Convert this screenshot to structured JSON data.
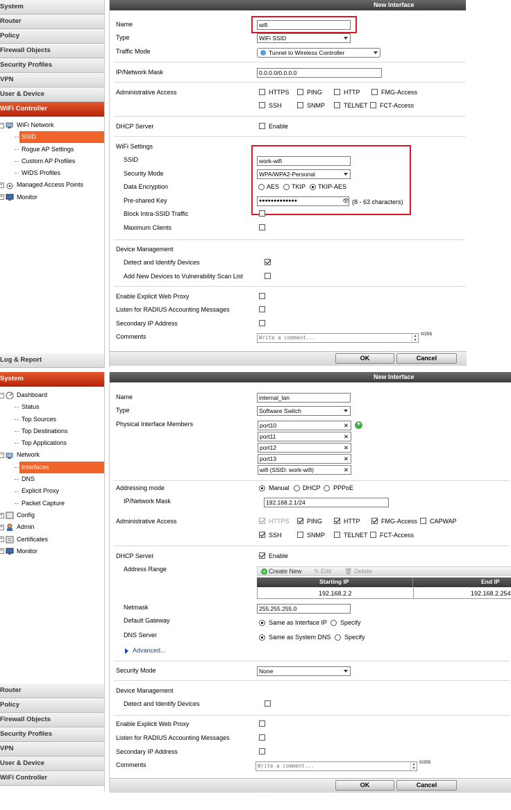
{
  "top_nav": {
    "headers_top": [
      "System",
      "Router",
      "Policy",
      "Firewall Objects",
      "Security Profiles",
      "VPN",
      "User & Device"
    ],
    "active": "WiFi Controller",
    "tree": [
      {
        "label": "WiFi Network",
        "level": 0
      },
      {
        "label": "SSID",
        "level": 1,
        "selected": true
      },
      {
        "label": "Rogue AP Settings",
        "level": 1
      },
      {
        "label": "Custom AP Profiles",
        "level": 1
      },
      {
        "label": "WIDS Profiles",
        "level": 1
      },
      {
        "label": "Managed Access Points",
        "level": 0
      },
      {
        "label": "Monitor",
        "level": 0
      }
    ],
    "footer": "Log & Report"
  },
  "bottom_nav": {
    "active": "System",
    "tree": [
      {
        "label": "Dashboard",
        "level": 0
      },
      {
        "label": "Status",
        "level": 1
      },
      {
        "label": "Top Sources",
        "level": 1
      },
      {
        "label": "Top Destinations",
        "level": 1
      },
      {
        "label": "Top Applications",
        "level": 1
      },
      {
        "label": "Network",
        "level": 0
      },
      {
        "label": "Interfaces",
        "level": 1,
        "selected": true
      },
      {
        "label": "DNS",
        "level": 1
      },
      {
        "label": "Explicit Proxy",
        "level": 1
      },
      {
        "label": "Packet Capture",
        "level": 1
      },
      {
        "label": "Config",
        "level": 0
      },
      {
        "label": "Admin",
        "level": 0
      },
      {
        "label": "Certificates",
        "level": 0
      },
      {
        "label": "Monitor",
        "level": 0
      }
    ],
    "headers_bottom": [
      "Router",
      "Policy",
      "Firewall Objects",
      "Security Profiles",
      "VPN",
      "User & Device",
      "WiFi Controller"
    ]
  },
  "wifi_form": {
    "title": "New Interface",
    "name_label": "Name",
    "name_value": "wifi",
    "type_label": "Type",
    "type_value": "WiFi SSID",
    "traffic_label": "Traffic Mode",
    "traffic_value": "Tunnel to Wireless Controller",
    "ip_label": "IP/Network Mask",
    "ip_value": "0.0.0.0/0.0.0.0",
    "admin_label": "Administrative Access",
    "access": {
      "https": "HTTPS",
      "ping": "PING",
      "http": "HTTP",
      "fmg": "FMG-Access",
      "ssh": "SSH",
      "snmp": "SNMP",
      "telnet": "TELNET",
      "fct": "FCT-Access"
    },
    "dhcp_label": "DHCP Server",
    "dhcp_enable": "Enable",
    "wifi_settings": "WiFi Settings",
    "ssid_label": "SSID",
    "ssid_value": "work-wifi",
    "secmode_label": "Security Mode",
    "secmode_value": "WPA/WPA2-Personal",
    "enc_label": "Data Encryption",
    "enc_aes": "AES",
    "enc_tkip": "TKIP",
    "enc_tkipaes": "TKIP-AES",
    "psk_label": "Pre-shared Key",
    "psk_value": "●●●●●●●●●●●●●",
    "psk_hint": "(8 - 63 characters)",
    "block_label": "Block Intra-SSID Traffic",
    "maxclients_label": "Maximum Clients",
    "devmgmt_label": "Device Management",
    "detect_label": "Detect and Identify Devices",
    "addnew_label": "Add New Devices to Vulnerability Scan List",
    "proxy_label": "Enable Explicit Web Proxy",
    "radius_label": "Listen for RADIUS Accounting Messages",
    "secondary_label": "Secondary IP Address",
    "comments_label": "Comments",
    "comment_placeholder": "Write a comment...",
    "comment_count": "0/255",
    "ok": "OK",
    "cancel": "Cancel"
  },
  "lan_form": {
    "title": "New Interface",
    "name_label": "Name",
    "name_value": "internal_lan",
    "type_label": "Type",
    "type_value": "Software Switch",
    "members_label": "Physical Interface Members",
    "members": [
      "port10",
      "port11",
      "port12",
      "port13",
      "wifi (SSID: work-wifi)"
    ],
    "addr_label": "Addressing mode",
    "addr_manual": "Manual",
    "addr_dhcp": "DHCP",
    "addr_pppoe": "PPPoE",
    "ip_label": "IP/Network Mask",
    "ip_value": "192.168.2.1/24",
    "admin_label": "Administrative Access",
    "access": {
      "https": "HTTPS",
      "ping": "PING",
      "http": "HTTP",
      "fmg": "FMG-Access",
      "capwap": "CAPWAP",
      "ssh": "SSH",
      "snmp": "SNMP",
      "telnet": "TELNET",
      "fct": "FCT-Access"
    },
    "dhcp_label": "DHCP Server",
    "dhcp_enable": "Enable",
    "range_label": "Address Range",
    "create_new": "Create New",
    "edit": "Edit",
    "delete": "Delete",
    "col_start": "Starting IP",
    "col_end": "End IP",
    "start_ip": "192.168.2.2",
    "end_ip": "192.168.2.254",
    "netmask_label": "Netmask",
    "netmask_value": "255.255.255.0",
    "gw_label": "Default Gateway",
    "gw_same": "Same as Interface IP",
    "gw_specify": "Specify",
    "dns_label": "DNS Server",
    "dns_same": "Same as System DNS",
    "dns_specify": "Specify",
    "advanced": "Advanced...",
    "secmode_label": "Security Mode",
    "secmode_value": "None",
    "devmgmt_label": "Device Management",
    "detect_label": "Detect and Identify Devices",
    "proxy_label": "Enable Explicit Web Proxy",
    "radius_label": "Listen for RADIUS Accounting Messages",
    "secondary_label": "Secondary IP Address",
    "comments_label": "Comments",
    "comment_placeholder": "Write a comment...",
    "comment_count": "0/255",
    "ok": "OK",
    "cancel": "Cancel"
  }
}
